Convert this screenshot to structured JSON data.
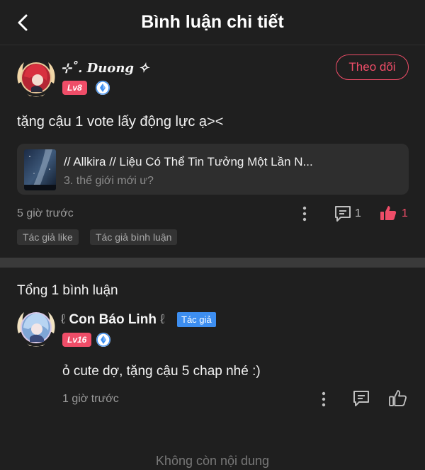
{
  "header": {
    "title": "Bình luận chi tiết",
    "back_icon": "chevron-left-icon"
  },
  "comment": {
    "username": "⊹˚. Duong ✧",
    "level": "Lv8",
    "follow_label": "Theo dõi",
    "text": "tặng cậu 1 vote lấy động lực ạ><",
    "story": {
      "title": "// Allkira // Liệu Có Thể Tin Tưởng Một Lần N...",
      "chapter": "3. thế giới mới ư?"
    },
    "time": "5 giờ trước",
    "comment_count": "1",
    "like_count": "1",
    "tags": [
      "Tác giả like",
      "Tác giả bình luận"
    ]
  },
  "replies": {
    "total_label": "Tổng 1 bình luận",
    "items": [
      {
        "deco_left": "ℓ",
        "username": "Con Báo Linh",
        "deco_right": "ℓ",
        "role_badge": "Tác giả",
        "level": "Lv16",
        "text": "ỏ cute dợ, tặng cậu 5 chap nhé :)",
        "time": "1 giờ trước"
      }
    ]
  },
  "footer": {
    "end_text": "Không còn nội dung"
  },
  "colors": {
    "background": "#1f1f1f",
    "accent": "#ef4d68",
    "author_badge": "#3d8ef0",
    "card": "#2e2e2e"
  }
}
